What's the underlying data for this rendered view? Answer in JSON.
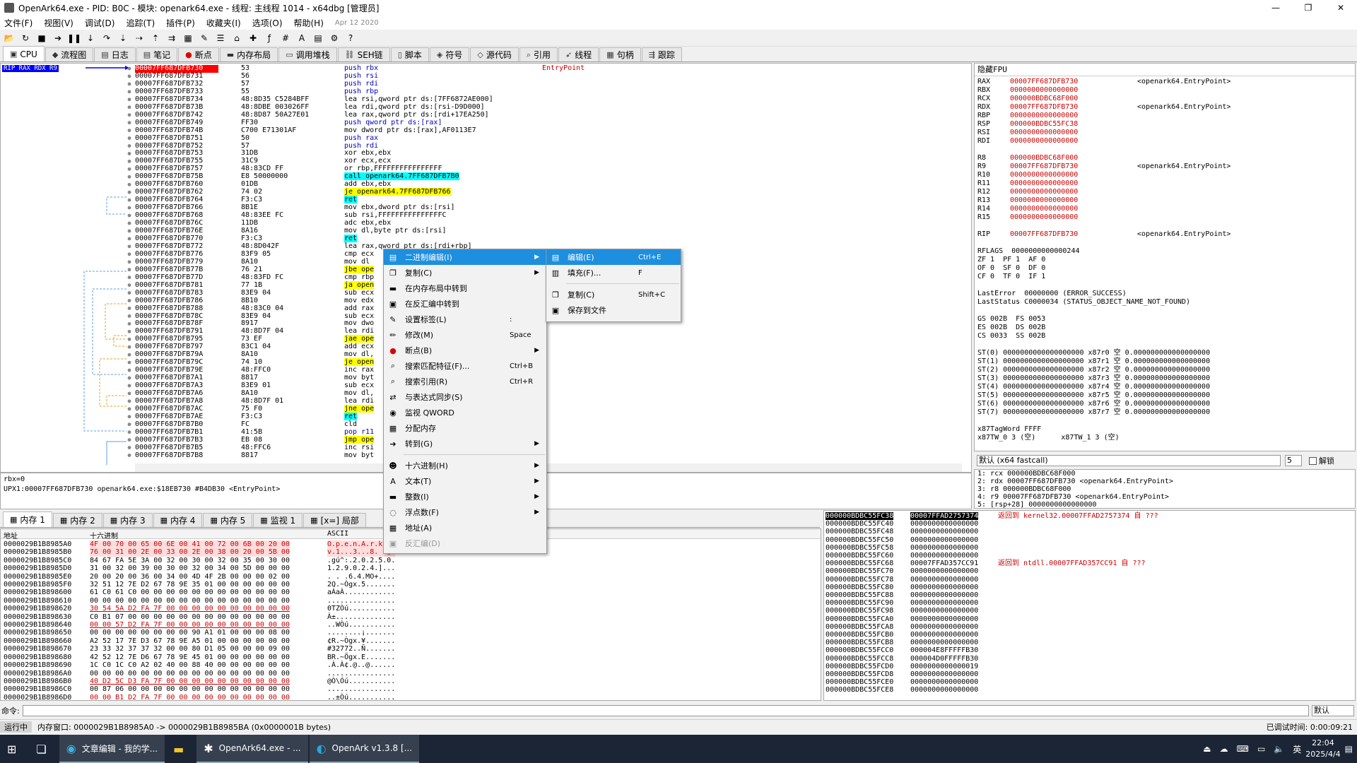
{
  "window": {
    "title": "OpenArk64.exe - PID: B0C - 模块: openark64.exe - 线程: 主线程 1014 - x64dbg [管理员]"
  },
  "menu": [
    "文件(F)",
    "视图(V)",
    "调试(D)",
    "追踪(T)",
    "插件(P)",
    "收藏夹(I)",
    "选项(O)",
    "帮助(H)"
  ],
  "menu_date": "Apr 12 2020",
  "tabs": [
    "CPU",
    "流程图",
    "日志",
    "笔记",
    "断点",
    "内存布局",
    "调用堆栈",
    "SEH链",
    "脚本",
    "符号",
    "源代码",
    "引用",
    "线程",
    "句柄",
    "跟踪"
  ],
  "cpu": {
    "rip_label": "RIP RAX RDX R9",
    "addresses": [
      "00007FF687DFB730",
      "00007FF687DFB731",
      "00007FF687DFB732",
      "00007FF687DFB733",
      "00007FF687DFB734",
      "00007FF687DFB73B",
      "00007FF687DFB742",
      "00007FF687DFB749",
      "00007FF687DFB74B",
      "00007FF687DFB751",
      "00007FF687DFB752",
      "00007FF687DFB753",
      "00007FF687DFB755",
      "00007FF687DFB757",
      "00007FF687DFB75B",
      "00007FF687DFB760",
      "00007FF687DFB762",
      "00007FF687DFB764",
      "00007FF687DFB766",
      "00007FF687DFB768",
      "00007FF687DFB76C",
      "00007FF687DFB76E",
      "00007FF687DFB770",
      "00007FF687DFB772",
      "00007FF687DFB776",
      "00007FF687DFB779",
      "00007FF687DFB77B",
      "00007FF687DFB77D",
      "00007FF687DFB781",
      "00007FF687DFB783",
      "00007FF687DFB786",
      "00007FF687DFB788",
      "00007FF687DFB78C",
      "00007FF687DFB78F",
      "00007FF687DFB791",
      "00007FF687DFB795",
      "00007FF687DFB797",
      "00007FF687DFB79A",
      "00007FF687DFB79C",
      "00007FF687DFB79E",
      "00007FF687DFB7A1",
      "00007FF687DFB7A3",
      "00007FF687DFB7A6",
      "00007FF687DFB7A8",
      "00007FF687DFB7AC",
      "00007FF687DFB7AE",
      "00007FF687DFB7B0",
      "00007FF687DFB7B1",
      "00007FF687DFB7B3",
      "00007FF687DFB7B5",
      "00007FF687DFB7B8"
    ],
    "bytes": [
      "53",
      "56",
      "57",
      "55",
      "48:8D35 C5284BFF",
      "48:8DBE 003026FF",
      "48:8D87 50A27E01",
      "FF30",
      "C700 E71301AF",
      "50",
      "57",
      "31DB",
      "31C9",
      "48:83CD FF",
      "E8 50000000",
      "01DB",
      "74 02",
      "F3:C3",
      "8B1E",
      "48:83EE FC",
      "11DB",
      "8A16",
      "F3:C3",
      "48:8D042F",
      "83F9 05",
      "8A10",
      "76 21",
      "48:83FD FC",
      "77 1B",
      "83E9 04",
      "8B10",
      "48:83C0 04",
      "83E9 04",
      "8917",
      "48:8D7F 04",
      "73 EF",
      "83C1 04",
      "8A10",
      "74 10",
      "48:FFC0",
      "8817",
      "83E9 01",
      "8A10",
      "48:8D7F 01",
      "75 F0",
      "F3:C3",
      "FC",
      "41:5B",
      "EB 08",
      "48:FFC6",
      "8817"
    ],
    "disasm": [
      "push rbx",
      "push rsi",
      "push rdi",
      "push rbp",
      "lea rsi,qword ptr ds:[7FF6872AE000]",
      "lea rdi,qword ptr ds:[rsi-D9D000]",
      "lea rax,qword ptr ds:[rdi+17EA250]",
      "push qword ptr ds:[rax]",
      "mov dword ptr ds:[rax],AF0113E7",
      "push rax",
      "push rdi",
      "xor ebx,ebx",
      "xor ecx,ecx",
      "or rbp,FFFFFFFFFFFFFFFF",
      "call openark64.7FF687DFB7B0",
      "add ebx,ebx",
      "je openark64.7FF687DFB766",
      "ret",
      "mov ebx,dword ptr ds:[rsi]",
      "sub rsi,FFFFFFFFFFFFFFFC",
      "adc ebx,ebx",
      "mov dl,byte ptr ds:[rsi]",
      "ret",
      "lea rax,qword ptr ds:[rdi+rbp]",
      "cmp ecx",
      "mov dl",
      "jbe ope",
      "cmp rbp",
      "ja open",
      "sub ecx",
      "mov edx",
      "add rax",
      "sub ecx",
      "mov dwo",
      "lea rdi",
      "jae ope",
      "add ecx",
      "mov dl,",
      "je open",
      "inc rax",
      "mov byt",
      "sub ecx",
      "mov dl,",
      "lea rdi",
      "jne ope",
      "ret",
      "cld",
      "pop r11",
      "jmp ope",
      "inc rsi",
      "mov byt"
    ],
    "comment": "EntryPoint"
  },
  "regs": {
    "header": "隐藏FPU",
    "gp1": [
      [
        "RAX",
        "00007FF687DFB730",
        "<openark64.EntryPoint>"
      ],
      [
        "RBX",
        "0000000000000000",
        ""
      ],
      [
        "RCX",
        "000000BDBC68F000",
        ""
      ],
      [
        "RDX",
        "00007FF687DFB730",
        "<openark64.EntryPoint>"
      ],
      [
        "RBP",
        "0000000000000000",
        ""
      ],
      [
        "RSP",
        "000000BDBC55FC38",
        ""
      ],
      [
        "RSI",
        "0000000000000000",
        ""
      ],
      [
        "RDI",
        "0000000000000000",
        ""
      ]
    ],
    "gp2": [
      [
        "R8",
        "000000BDBC68F000",
        ""
      ],
      [
        "R9",
        "00007FF687DFB730",
        "<openark64.EntryPoint>"
      ],
      [
        "R10",
        "0000000000000000",
        ""
      ],
      [
        "R11",
        "0000000000000000",
        ""
      ],
      [
        "R12",
        "0000000000000000",
        ""
      ],
      [
        "R13",
        "0000000000000000",
        ""
      ],
      [
        "R14",
        "0000000000000000",
        ""
      ],
      [
        "R15",
        "0000000000000000",
        ""
      ]
    ],
    "rip": [
      "RIP",
      "00007FF687DFB730",
      "<openark64.EntryPoint>"
    ],
    "rflags": "RFLAGS  0000000000000244",
    "flags": [
      "ZF 1  PF 1  AF 0",
      "OF 0  SF 0  DF 0",
      "CF 0  TF 0  IF 1"
    ],
    "lasterror": "LastError  00000000 (ERROR_SUCCESS)",
    "laststatus": "LastStatus C0000034 (STATUS_OBJECT_NAME_NOT_FOUND)",
    "segs": [
      "GS 002B  FS 0053",
      "ES 002B  DS 002B",
      "CS 0033  SS 002B"
    ],
    "st": [
      "ST(0) 0000000000000000000 x87r0 空 0.000000000000000000",
      "ST(1) 0000000000000000000 x87r1 空 0.000000000000000000",
      "ST(2) 0000000000000000000 x87r2 空 0.000000000000000000",
      "ST(3) 0000000000000000000 x87r3 空 0.000000000000000000",
      "ST(4) 0000000000000000000 x87r4 空 0.000000000000000000",
      "ST(5) 0000000000000000000 x87r5 空 0.000000000000000000",
      "ST(6) 0000000000000000000 x87r6 空 0.000000000000000000",
      "ST(7) 0000000000000000000 x87r7 空 0.000000000000000000"
    ],
    "tagword": "x87TagWord FFFF",
    "tw": "x87TW_0 3 (空)      x87TW_1 3 (空)"
  },
  "callconv": {
    "label": "默认 (x64 fastcall)",
    "count": "5",
    "unlock": "解锁"
  },
  "args": [
    "1: rcx 000000BDBC68F000",
    "2: rdx 00007FF687DFB730 <openark64.EntryPoint>",
    "3: r8 000000BDBC68F000",
    "4: r9 00007FF687DFB730 <openark64.EntryPoint>",
    "5: [rsp+28] 0000000000000000"
  ],
  "info": {
    "line1": "rbx=0",
    "line2": "UPX1:00007FF687DFB730 openark64.exe:$18EB730 #B4DB30 <EntryPoint>"
  },
  "btabs": [
    "内存 1",
    "内存 2",
    "内存 3",
    "内存 4",
    "内存 5",
    "监视 1",
    "[x=] 局部"
  ],
  "dump": {
    "headers": {
      "addr": "地址",
      "hex": "十六进制",
      "ascii": "ASCII"
    },
    "addrs": [
      "0000029B1B8985A0",
      "0000029B1B8985B0",
      "0000029B1B8985C0",
      "0000029B1B8985D0",
      "0000029B1B8985E0",
      "0000029B1B8985F0",
      "0000029B1B898600",
      "0000029B1B898610",
      "0000029B1B898620",
      "0000029B1B898630",
      "0000029B1B898640",
      "0000029B1B898650",
      "0000029B1B898660",
      "0000029B1B898670",
      "0000029B1B898680",
      "0000029B1B898690",
      "0000029B1B8986A0",
      "0000029B1B8986B0",
      "0000029B1B8986C0",
      "0000029B1B8986D0",
      "0000029B1B8986E0"
    ],
    "hex": [
      "4F 00 70 00 65 00 6E 00 41 00 72 00 6B 00 20 00",
      "76 00 31 00 2E 00 33 00 2E 00 38 00 20 00 5B 00",
      "84 67 FA 5E 3A 00 32 00 30 00 32 00 35 00 30 00",
      "31 00 32 00 39 00 30 00 32 00 34 00 5D 00 00 00",
      "20 00 20 00 36 00 34 00 4D 4F 2B 00 00 00 02 00",
      "32 51 12 7E D2 67 78 9E 35 01 00 00 00 00 00 00",
      "61 C0 61 C0 00 00 00 00 00 00 00 00 00 00 00 00",
      "00 00 00 00 00 00 00 00 00 00 00 00 00 00 00 00",
      "30 54 5A D2 FA 7F 00 00 00 00 00 00 00 00 00 00",
      "C0 B1 07 00 00 00 00 00 00 00 00 00 00 00 00 00",
      "00 00 57 D2 FA 7F 00 00 00 00 00 00 00 00 00 00",
      "00 00 00 00 00 00 00 00 90 A1 01 00 00 00 08 00",
      "A2 52 17 7E D3 67 78 9E A5 01 00 00 00 00 00 00",
      "23 33 32 37 37 32 00 00 80 D1 05 00 00 00 09 00",
      "42 52 12 7E D6 67 78 9E 45 01 00 00 00 00 00 00",
      "1C C0 1C C0 A2 02 40 00 88 40 00 00 00 00 00 00",
      "00 00 00 00 00 00 00 00 00 00 00 00 00 00 00 00",
      "40 D2 5C D3 FA 7F 00 00 00 00 00 00 00 00 00 00",
      "00 87 06 00 00 00 00 00 00 00 00 00 00 00 00 00",
      "00 00 B1 D2 FA 7F 00 00 00 00 00 00 00 00 00 00",
      "08 00 00 00 00 00 00 00 00 00 00 00 00 00 00 00"
    ],
    "ascii": [
      "O.p.e.n.A.r.k. .",
      "v.1...3...8. .[.",
      ".gú^:.2.0.2.5.0.",
      "1.2.9.0.2.4.]...",
      ". . .6.4.MO+....",
      "2Q.~Ògx.5.......",
      "aÀaÀ............",
      "................",
      "0TZÒú...........",
      "À±..............",
      "..WÒú...........",
      "........¡.......",
      "¢R.~Ògx.¥.......",
      "#32772..Ñ.......",
      "BR.~Ögx.E.......",
      ".À.À¢.@..@......",
      "................",
      "@Ò\\Óú...........",
      "................",
      "..±Òú...........",
      "................"
    ]
  },
  "stack": {
    "addrs": [
      "000000BDBC55FC38",
      "000000BDBC55FC40",
      "000000BDBC55FC48",
      "000000BDBC55FC50",
      "000000BDBC55FC58",
      "000000BDBC55FC60",
      "000000BDBC55FC68",
      "000000BDBC55FC70",
      "000000BDBC55FC78",
      "000000BDBC55FC80",
      "000000BDBC55FC88",
      "000000BDBC55FC90",
      "000000BDBC55FC98",
      "000000BDBC55FCA0",
      "000000BDBC55FCA8",
      "000000BDBC55FCB0",
      "000000BDBC55FCB8",
      "000000BDBC55FCC0",
      "000000BDBC55FCC8",
      "000000BDBC55FCD0",
      "000000BDBC55FCD8",
      "000000BDBC55FCE0",
      "000000BDBC55FCE8"
    ],
    "vals": [
      "00007FFAD2757374",
      "0000000000000000",
      "0000000000000000",
      "0000000000000000",
      "0000000000000000",
      "0000000000000000",
      "00007FFAD357CC91",
      "0000000000000000",
      "0000000000000000",
      "0000000000000000",
      "0000000000000000",
      "0000000000000000",
      "0000000000000000",
      "0000000000000000",
      "0000000000000000",
      "0000000000000000",
      "0000000000000000",
      "000004E8FFFFFB30",
      "000004D0FFFFFB30",
      "0000000000000019",
      "0000000000000000",
      "0000000000000000",
      "0000000000000000"
    ],
    "comments": [
      "返回到 kernel32.00007FFAD2757374 自 ???",
      "",
      "",
      "",
      "",
      "",
      "返回到 ntdll.00007FFAD357CC91 自 ???"
    ]
  },
  "cmd": {
    "label": "命令:",
    "default": "默认"
  },
  "status": {
    "state": "运行中",
    "msg": "内存窗口: 0000029B1B8985A0 -> 0000029B1B8985BA (0x0000001B bytes)",
    "time": "已调试时间: 0:00:09:21"
  },
  "context_menu": [
    {
      "label": "二进制编辑(I)",
      "arrow": true,
      "hl": true,
      "icon": "binary-edit-icon"
    },
    {
      "label": "复制(C)",
      "arrow": true,
      "icon": "copy-icon"
    },
    {
      "label": "在内存布局中转到",
      "icon": "memory-map-icon"
    },
    {
      "label": "在反汇编中转到",
      "icon": "disasm-icon"
    },
    {
      "label": "设置标签(L)",
      "sc": ":",
      "icon": "label-icon"
    },
    {
      "label": "修改(M)",
      "sc": "Space",
      "icon": "modify-icon"
    },
    {
      "label": "断点(B)",
      "arrow": true,
      "icon": "breakpoint-icon"
    },
    {
      "label": "搜索匹配特征(F)...",
      "sc": "Ctrl+B",
      "icon": "search-pattern-icon"
    },
    {
      "label": "搜索引用(R)",
      "sc": "Ctrl+R",
      "icon": "search-ref-icon"
    },
    {
      "label": "与表达式同步(S)",
      "icon": "sync-icon"
    },
    {
      "label": "监视 QWORD",
      "icon": "watch-icon"
    },
    {
      "label": "分配内存",
      "icon": "alloc-icon"
    },
    {
      "label": "转到(G)",
      "arrow": true,
      "icon": "goto-icon"
    },
    {
      "sep": true
    },
    {
      "label": "十六进制(H)",
      "arrow": true,
      "icon": "hex-icon"
    },
    {
      "label": "文本(T)",
      "arrow": true,
      "icon": "text-icon"
    },
    {
      "label": "整数(I)",
      "arrow": true,
      "icon": "integer-icon"
    },
    {
      "label": "浮点数(F)",
      "arrow": true,
      "icon": "float-icon"
    },
    {
      "label": "地址(A)",
      "icon": "address-icon"
    },
    {
      "label": "反汇编(D)",
      "dis": true,
      "icon": "disassemble-icon"
    }
  ],
  "submenu": [
    {
      "label": "编辑(E)",
      "sc": "Ctrl+E",
      "hl": true,
      "icon": "edit-icon"
    },
    {
      "label": "填充(F)...",
      "sc": "F",
      "icon": "fill-icon"
    },
    {
      "sep": true
    },
    {
      "label": "复制(C)",
      "sc": "Shift+C",
      "icon": "copy-icon"
    },
    {
      "label": "保存到文件",
      "icon": "save-file-icon"
    }
  ],
  "taskbar": {
    "apps": [
      "文章编辑 - 我的学...",
      "",
      "OpenArk64.exe - ...",
      "OpenArk v1.3.8 [..."
    ],
    "ime": "英",
    "time": "22:04",
    "date": "2025/4/4"
  }
}
